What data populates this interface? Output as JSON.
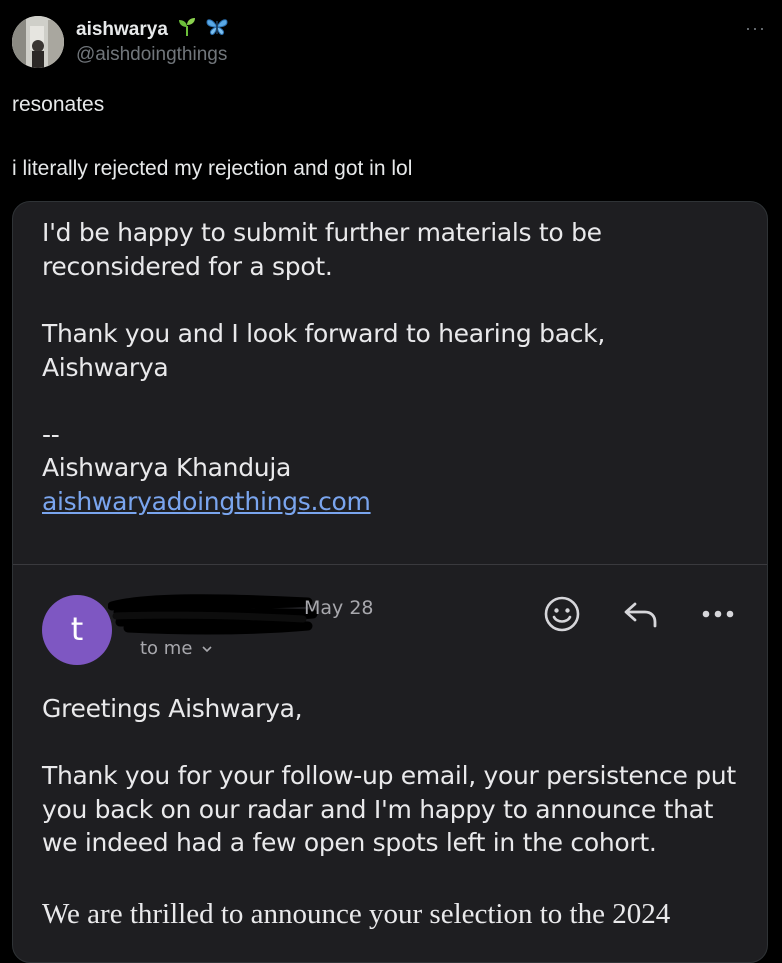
{
  "tweet": {
    "author": {
      "display_name": "aishwarya",
      "handle": "@aishdoingthings",
      "emojis": [
        "seedling-emoji",
        "butterfly-emoji"
      ]
    },
    "more_label": "···",
    "text_lines": [
      "resonates",
      "i literally rejected my rejection and got in lol"
    ]
  },
  "email": {
    "previous_message": {
      "lines": [
        "I'd be happy to submit further materials to be",
        "reconsidered for a spot.",
        "Thank you and I look forward to hearing back,",
        "Aishwarya",
        "--",
        "Aishwarya Khanduja"
      ],
      "signature_link": "aishwaryadoingthings.com"
    },
    "reply": {
      "sender_initial": "t",
      "date": "May 28",
      "to_label": "to me",
      "greeting": "Greetings Aishwarya,",
      "body_lines": [
        "Thank you for your follow-up email, your persistence put",
        "you back on our radar and I'm happy to announce that",
        "we indeed had a few open spots left in the cohort."
      ],
      "serif_line": "We are thrilled to announce your selection to the 2024"
    },
    "colors": {
      "background": "#1e1e21",
      "avatar": "#7e57c2",
      "link": "#7aa5ee"
    }
  }
}
